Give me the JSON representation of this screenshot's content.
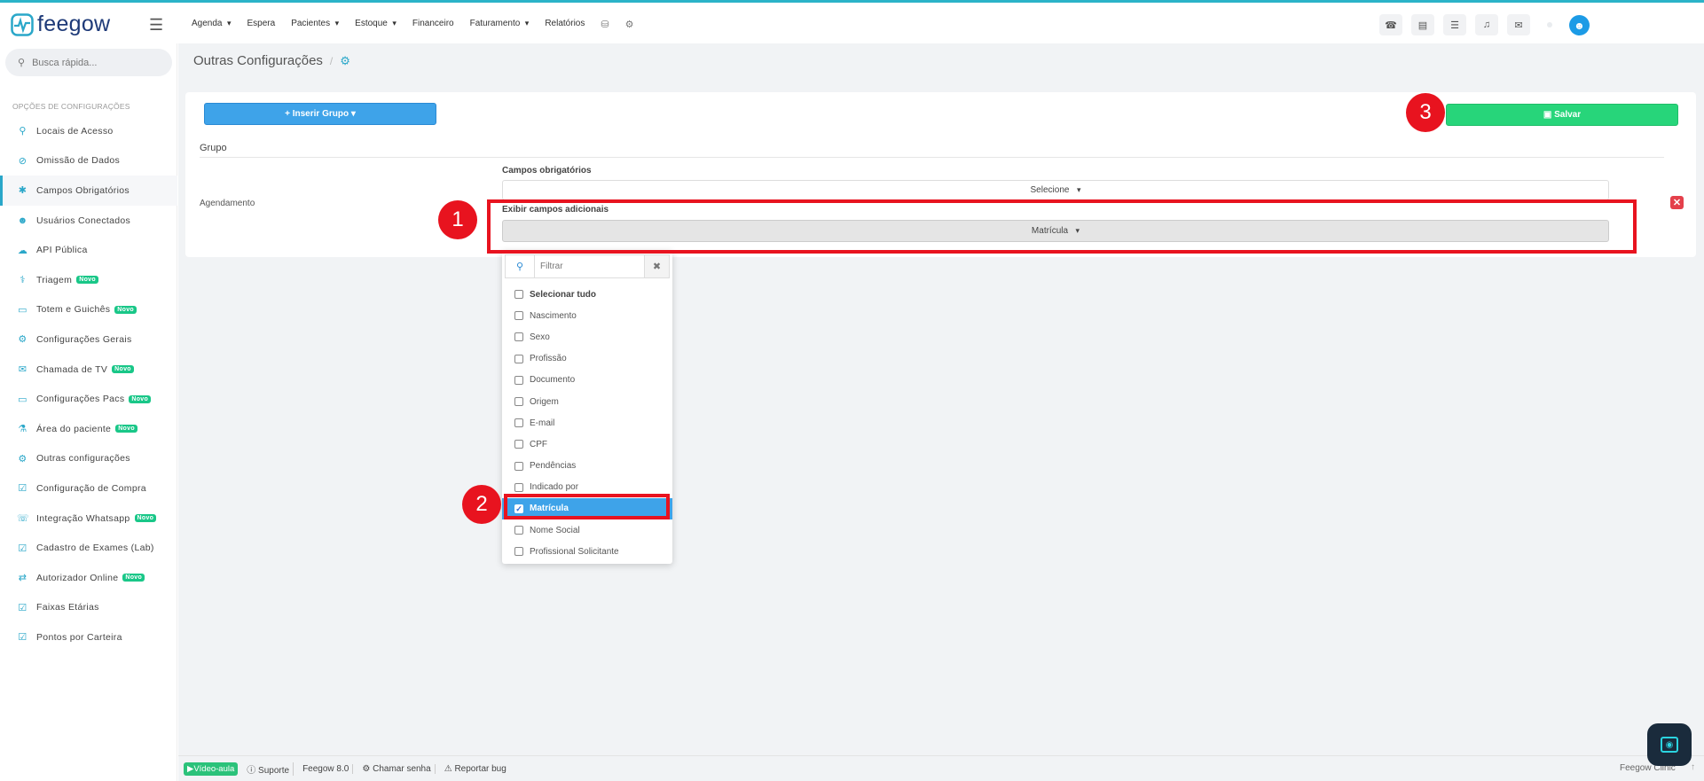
{
  "brand": {
    "name": "feegow"
  },
  "nav": {
    "items": [
      {
        "label": "Agenda",
        "caret": true
      },
      {
        "label": "Espera",
        "caret": false
      },
      {
        "label": "Pacientes",
        "caret": true
      },
      {
        "label": "Estoque",
        "caret": true
      },
      {
        "label": "Financeiro",
        "caret": false
      },
      {
        "label": "Faturamento",
        "caret": true
      },
      {
        "label": "Relatórios",
        "caret": false
      }
    ]
  },
  "sidebar": {
    "search_placeholder": "Busca rápida...",
    "section_title": "OPÇÕES DE CONFIGURAÇÕES",
    "items": [
      {
        "label": "Locais de Acesso",
        "icon": "location-icon",
        "badge": ""
      },
      {
        "label": "Omissão de Dados",
        "icon": "eye-slash-icon",
        "badge": ""
      },
      {
        "label": "Campos Obrigatórios",
        "icon": "asterisk-icon",
        "badge": "",
        "active": true
      },
      {
        "label": "Usuários Conectados",
        "icon": "user-icon",
        "badge": ""
      },
      {
        "label": "API Pública",
        "icon": "cloud-icon",
        "badge": ""
      },
      {
        "label": "Triagem",
        "icon": "stethoscope-icon",
        "badge": "Novo"
      },
      {
        "label": "Totem e Guichês",
        "icon": "laptop-icon",
        "badge": "Novo"
      },
      {
        "label": "Configurações Gerais",
        "icon": "gears-icon",
        "badge": ""
      },
      {
        "label": "Chamada de TV",
        "icon": "megaphone-icon",
        "badge": "Novo"
      },
      {
        "label": "Configurações Pacs",
        "icon": "laptop-icon",
        "badge": "Novo"
      },
      {
        "label": "Área do paciente",
        "icon": "flask-icon",
        "badge": "Novo"
      },
      {
        "label": "Outras configurações",
        "icon": "gears-icon",
        "badge": ""
      },
      {
        "label": "Configuração de Compra",
        "icon": "cart-icon",
        "badge": ""
      },
      {
        "label": "Integração Whatsapp",
        "icon": "whatsapp-icon",
        "badge": "Novo"
      },
      {
        "label": "Cadastro de Exames (Lab)",
        "icon": "cart-icon",
        "badge": ""
      },
      {
        "label": "Autorizador Online",
        "icon": "exchange-icon",
        "badge": "Novo"
      },
      {
        "label": "Faixas Etárias",
        "icon": "cart-icon",
        "badge": ""
      },
      {
        "label": "Pontos por Carteira",
        "icon": "cart-icon",
        "badge": ""
      }
    ]
  },
  "page": {
    "title": "Outras Configurações",
    "separator": "/",
    "insert_group_label": "Inserir Grupo",
    "save_label": "Salvar",
    "group_header": "Grupo",
    "group_name": "Agendamento",
    "required_label": "Campos obrigatórios",
    "required_value": "Selecione",
    "additional_label": "Exibir campos adicionais",
    "additional_value": "Matrícula"
  },
  "dropdown": {
    "filter_placeholder": "Filtrar",
    "options": [
      {
        "label": "Selecionar tudo",
        "checked": false,
        "bold": true
      },
      {
        "label": "Nascimento",
        "checked": false
      },
      {
        "label": "Sexo",
        "checked": false
      },
      {
        "label": "Profissão",
        "checked": false
      },
      {
        "label": "Documento",
        "checked": false
      },
      {
        "label": "Origem",
        "checked": false
      },
      {
        "label": "E-mail",
        "checked": false
      },
      {
        "label": "CPF",
        "checked": false
      },
      {
        "label": "Pendências",
        "checked": false
      },
      {
        "label": "Indicado por",
        "checked": false
      },
      {
        "label": "Matrícula",
        "checked": true
      },
      {
        "label": "Nome Social",
        "checked": false
      },
      {
        "label": "Profissional Solicitante",
        "checked": false
      }
    ]
  },
  "annotations": {
    "step1": "1",
    "step2": "2",
    "step3": "3"
  },
  "footer": {
    "video": "Vídeo-aula",
    "support": "Suporte",
    "version": "Feegow 8.0",
    "call": "Chamar senha",
    "bug": "Reportar bug",
    "clinic": "Feegow Clinic"
  },
  "colors": {
    "accent": "#2aa7c9",
    "save": "#27d57a",
    "insert": "#3ea3e9",
    "highlight": "#e8131f"
  }
}
